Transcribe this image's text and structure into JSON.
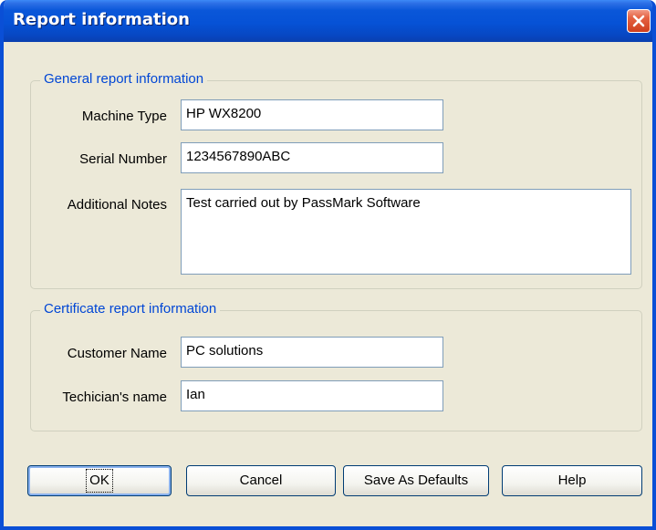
{
  "window": {
    "title": "Report information"
  },
  "general": {
    "legend": "General report information",
    "machine_type": {
      "label": "Machine Type",
      "value": "HP WX8200"
    },
    "serial_number": {
      "label": "Serial Number",
      "value": "1234567890ABC"
    },
    "additional_notes": {
      "label": "Additional Notes",
      "value": "Test carried out by PassMark Software"
    }
  },
  "certificate": {
    "legend": "Certificate report information",
    "customer_name": {
      "label": "Customer Name",
      "value": "PC solutions"
    },
    "technician_name": {
      "label": "Techician's name",
      "value": "Ian"
    }
  },
  "buttons": {
    "ok": "OK",
    "cancel": "Cancel",
    "save_defaults": "Save As Defaults",
    "help": "Help"
  },
  "colors": {
    "titlebar": "#0652d6",
    "legend_text": "#0046d5",
    "dialog_bg": "#ece9d8",
    "close_button": "#e56243"
  },
  "icons": {
    "close": "close-icon"
  }
}
